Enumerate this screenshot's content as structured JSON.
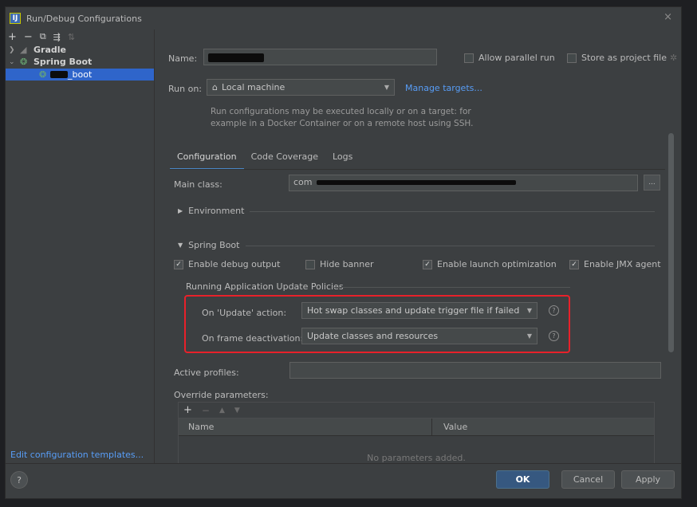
{
  "window": {
    "title": "Run/Debug Configurations",
    "close": "×"
  },
  "sidebar": {
    "toolbar": [
      "+",
      "−",
      "⧉",
      "⇶",
      "⇅"
    ],
    "tree": [
      {
        "label": "Gradle",
        "expanded": false
      },
      {
        "label": "Spring Boot",
        "expanded": true
      },
      {
        "label": "_boot",
        "selected": true
      }
    ],
    "edit_templates": "Edit configuration templates..."
  },
  "form": {
    "name_label": "Name:",
    "allow_parallel": "Allow parallel run",
    "store_as_project": "Store as project file",
    "run_on_label": "Run on:",
    "run_on_value": "Local machine",
    "manage_targets": "Manage targets...",
    "info_line1": "Run configurations may be executed locally or on a target: for",
    "info_line2": "example in a Docker Container or on a remote host using SSH."
  },
  "tabs": [
    "Configuration",
    "Code Coverage",
    "Logs"
  ],
  "config": {
    "main_class_label": "Main class:",
    "main_class_value": "com",
    "ellipsis": "...",
    "environment": "Environment",
    "spring_boot": "Spring Boot",
    "enable_debug": "Enable debug output",
    "hide_banner": "Hide banner",
    "enable_launch_opt": "Enable launch optimization",
    "enable_jmx": "Enable JMX agent",
    "running_policies": "Running Application Update Policies",
    "on_update_label": "On 'Update' action:",
    "on_update_value": "Hot swap classes and update trigger file if failed",
    "on_frame_label": "On frame deactivation:",
    "on_frame_value": "Update classes and resources",
    "active_profiles": "Active profiles:",
    "override_params": "Override parameters:",
    "params_add": "+",
    "params_remove": "−",
    "params_up": "▲",
    "params_down": "▼",
    "col_name": "Name",
    "col_value": "Value",
    "empty": "No parameters added."
  },
  "footer": {
    "help": "?",
    "ok": "OK",
    "cancel": "Cancel",
    "apply": "Apply"
  },
  "colors": {
    "accent": "#2f65ca",
    "link": "#589df6",
    "highlight": "#e8212a"
  }
}
